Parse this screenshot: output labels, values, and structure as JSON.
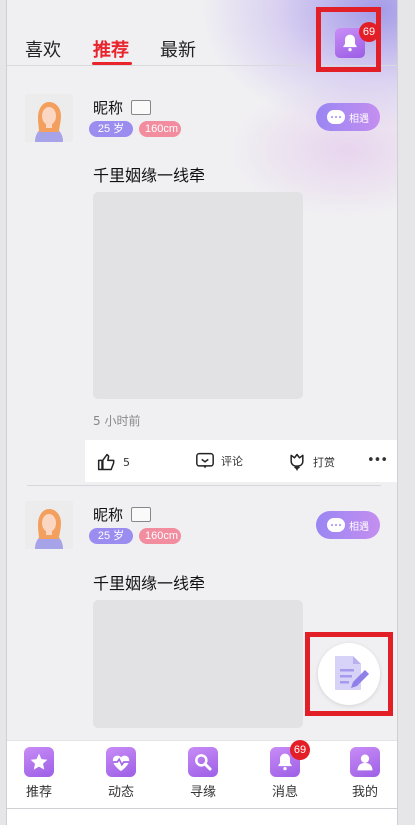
{
  "tabs": [
    {
      "label": "喜欢"
    },
    {
      "label": "推荐"
    },
    {
      "label": "最新"
    }
  ],
  "notification_badge": "69",
  "posts": [
    {
      "nickname": "昵称",
      "age": "25 岁",
      "height": "160cm",
      "meet_label": "相遇",
      "caption": "千里姻缘一线牵",
      "time": "5 小时前",
      "likes": "5",
      "comment_label": "评论",
      "reward_label": "打赏",
      "more": "•••"
    },
    {
      "nickname": "昵称",
      "age": "25 岁",
      "height": "160cm",
      "meet_label": "相遇",
      "caption": "千里姻缘一线牵"
    }
  ],
  "nav": [
    {
      "label": "推荐",
      "icon": "star-icon"
    },
    {
      "label": "动态",
      "icon": "heartbeat-icon"
    },
    {
      "label": "寻缘",
      "icon": "search-icon"
    },
    {
      "label": "消息",
      "icon": "bell-icon",
      "badge": "69"
    },
    {
      "label": "我的",
      "icon": "user-icon"
    }
  ],
  "colors": {
    "accent_red": "#e8242c",
    "purple": "#9b5de5",
    "age_tag": "#9b8cf0",
    "height_tag": "#f28da0"
  }
}
